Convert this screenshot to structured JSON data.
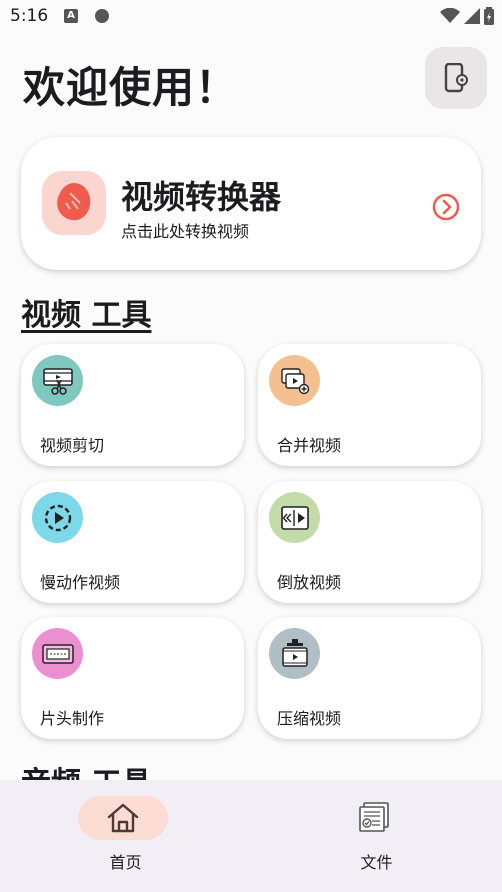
{
  "status_bar": {
    "time": "5:16",
    "a_glyph": "A"
  },
  "header": {
    "title": "欢迎使用！"
  },
  "converter": {
    "title": "视频转换器",
    "subtitle": "点击此处转换视频"
  },
  "video_section": {
    "title": "视频 工具",
    "tools": [
      {
        "label": "视频剪切",
        "icon": "video-cut-icon",
        "color": "#7ec8c0"
      },
      {
        "label": "合并视频",
        "icon": "merge-video-icon",
        "color": "#f5c08f"
      },
      {
        "label": "慢动作视频",
        "icon": "slow-motion-icon",
        "color": "#7dd8e8"
      },
      {
        "label": "倒放视频",
        "icon": "reverse-video-icon",
        "color": "#c3dba8"
      },
      {
        "label": "片头制作",
        "icon": "intro-maker-icon",
        "color": "#ec8fd1"
      },
      {
        "label": "压缩视频",
        "icon": "compress-video-icon",
        "color": "#b0bec5"
      }
    ]
  },
  "audio_section": {
    "title": "音频 工具"
  },
  "bottom_nav": {
    "home_label": "首页",
    "files_label": "文件"
  },
  "colors": {
    "accent": "#ef5b4c",
    "active_nav": "#fcdcd3",
    "nav_bg": "#f2eef6"
  }
}
